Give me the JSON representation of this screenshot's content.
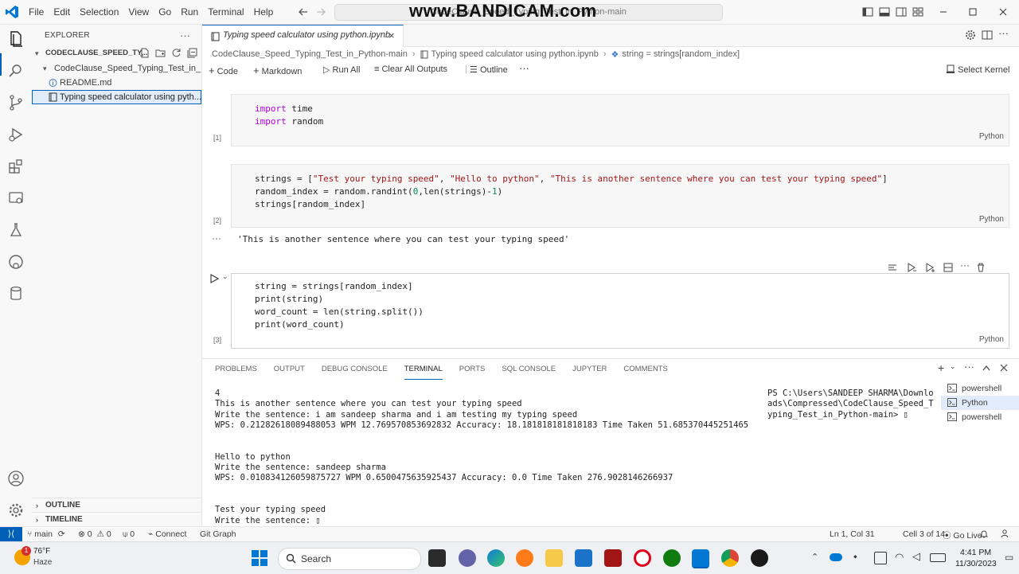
{
  "menu": [
    "File",
    "Edit",
    "Selection",
    "View",
    "Go",
    "Run",
    "Terminal",
    "Help"
  ],
  "command_center": "CodeClause_Speed_Typing_Test_in_Python-main",
  "watermark": "www.BANDICAM.com",
  "explorer": {
    "header": "EXPLORER",
    "more": "···",
    "root": "CODECLAUSE_SPEED_TY...",
    "folder": "CodeClause_Speed_Typing_Test_in_P...",
    "files": [
      "README.md",
      "Typing speed calculator using pyth..."
    ],
    "outline": "OUTLINE",
    "timeline": "TIMELINE"
  },
  "tab": {
    "label": "Typing speed calculator using python.ipynb",
    "close": "×"
  },
  "breadcrumb": [
    "CodeClause_Speed_Typing_Test_in_Python-main",
    "Typing speed calculator using python.ipynb",
    "string = strings[random_index]"
  ],
  "notebook_toolbar": {
    "code": "Code",
    "markdown": "Markdown",
    "run_all": "Run All",
    "clear_outputs": "Clear All Outputs",
    "outline": "Outline",
    "more": "···",
    "kernel": "Select Kernel"
  },
  "cells": [
    {
      "count": "[1]",
      "language": "Python"
    },
    {
      "count": "[2]",
      "language": "Python",
      "output": "'This is another sentence where you can test your typing speed'",
      "output_dots": "···"
    },
    {
      "count": "[3]",
      "language": "Python"
    }
  ],
  "code_text": {
    "c1_l1_kw": "import",
    "c1_l1_rest": " time",
    "c1_l2_kw": "import",
    "c1_l2_rest": " random",
    "c2_l1_a": "strings = [",
    "c2_l1_s1": "\"Test your typing speed\"",
    "c2_l1_s2": "\"Hello to python\"",
    "c2_l1_s3": "\"This is another sentence where you can test your typing speed\"",
    "c2_l1_end": "]",
    "comma": ", ",
    "c2_l2_a": "random_index = random.randint(",
    "c2_l2_zero": "0",
    "c2_l2_b": ",len(strings)-",
    "c2_l2_one": "1",
    "c2_l2_end": ")",
    "c2_l3": "strings[random_index]",
    "c3_l1": "string = strings[random_index]",
    "c3_l2": "print(string)",
    "c3_l3": "word_count = len(string.split())",
    "c3_l4": "print(word_count)"
  },
  "panel": {
    "tabs": [
      "PROBLEMS",
      "OUTPUT",
      "DEBUG CONSOLE",
      "TERMINAL",
      "PORTS",
      "SQL CONSOLE",
      "JUPYTER",
      "COMMENTS"
    ],
    "active_tab": "TERMINAL",
    "terminal_lines": [
      "4",
      "This is another sentence where you can test your typing speed",
      "Write the sentence: i am sandeep sharma and i am testing my typing speed",
      "WPS: 0.21282618089488053 WPM 12.769570853692832 Accuracy: 18.181818181818183 Time Taken 51.685370445251465",
      "",
      "",
      "Hello to python",
      "Write the sentence: sandeep sharma",
      "WPS: 0.010834126059875727 WPM 0.6500475635925437 Accuracy: 0.0 Time Taken 276.9028146266937",
      "",
      "",
      "Test your typing speed",
      "Write the sentence: ▯"
    ],
    "prompt_lines": [
      "PS C:\\Users\\SANDEEP SHARMA\\Downlo",
      "ads\\Compressed\\CodeClause_Speed_T",
      "yping_Test_in_Python-main> ▯"
    ],
    "terminals": [
      "powershell",
      "Python",
      "powershell"
    ]
  },
  "status": {
    "branch": "main",
    "errors": "0",
    "warnings": "0",
    "ports": "0",
    "connect": "Connect",
    "git_graph": "Git Graph",
    "position": "Ln 1, Col 31",
    "cell": "Cell 3 of 14",
    "go_live": "Go Live"
  },
  "taskbar": {
    "badge": "1",
    "temp": "76°F",
    "condition": "Haze",
    "search": "Search",
    "time": "4:41 PM",
    "date": "11/30/2023"
  },
  "colors": {
    "accent": "#005fb8",
    "keyword": "#af00db",
    "string": "#a31515",
    "number": "#098658"
  }
}
